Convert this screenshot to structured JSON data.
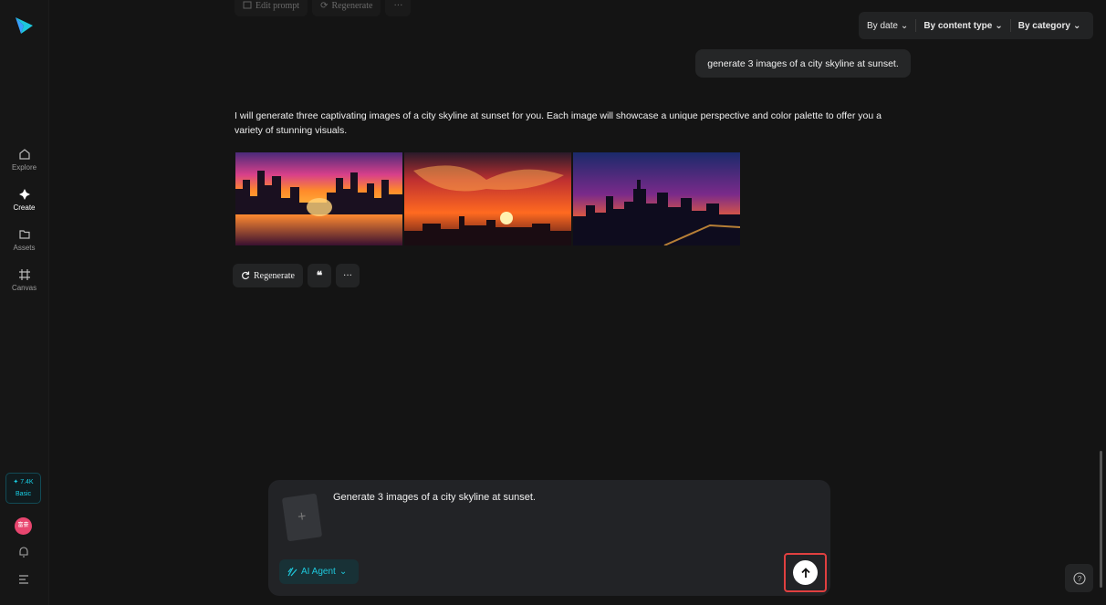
{
  "sidebar": {
    "nav": [
      {
        "label": "Explore",
        "icon": "home-icon"
      },
      {
        "label": "Create",
        "icon": "sparkle-icon"
      },
      {
        "label": "Assets",
        "icon": "folder-icon"
      },
      {
        "label": "Canvas",
        "icon": "canvas-icon"
      }
    ],
    "credits": {
      "value": "7.4K",
      "plan": "Basic"
    },
    "avatar_text": "富豪"
  },
  "faded_toolbar": {
    "edit_prompt": "Edit prompt",
    "regenerate": "Regenerate"
  },
  "filters": {
    "by_date": "By date",
    "by_content_type": "By content type",
    "by_category": "By category"
  },
  "chat": {
    "user_message": "generate 3 images of a city skyline at sunset.",
    "ai_message": "I will generate three captivating images of a city skyline at sunset for you. Each image will showcase a unique perspective and color palette to offer you a variety of stunning visuals."
  },
  "actions": {
    "regenerate": "Regenerate"
  },
  "composer": {
    "prompt": "Generate 3 images of a city skyline at sunset.",
    "agent_label": "AI Agent"
  },
  "colors": {
    "accent": "#1ec8dc",
    "highlight": "#e04040"
  }
}
